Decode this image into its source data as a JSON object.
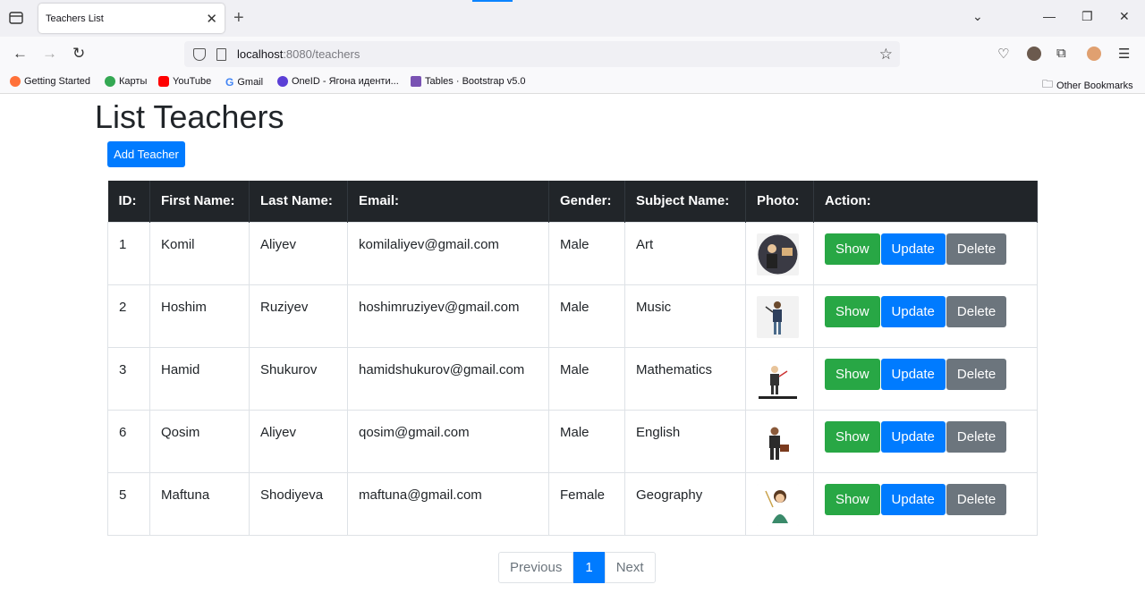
{
  "browser": {
    "tab_title": "Teachers List",
    "url_host": "localhost",
    "url_path": ":8080/teachers",
    "bookmarks": [
      {
        "label": "Getting Started",
        "color": "#ff7139"
      },
      {
        "label": "Карты",
        "color": "#34a853"
      },
      {
        "label": "YouTube",
        "color": "#ff0000"
      },
      {
        "label": "Gmail",
        "color": "#4285f4"
      },
      {
        "label": "OneID - Ягона иденти...",
        "color": "#5b3fd6"
      },
      {
        "label": "Tables · Bootstrap v5.0",
        "color": "#7952b3"
      }
    ],
    "other_bookmarks": "Other Bookmarks"
  },
  "page": {
    "title": "List Teachers",
    "add_button": "Add Teacher"
  },
  "table": {
    "headers": [
      "ID:",
      "First Name:",
      "Last Name:",
      "Email:",
      "Gender:",
      "Subject Name:",
      "Photo:",
      "Action:"
    ],
    "rows": [
      {
        "id": "1",
        "first": "Komil",
        "last": "Aliyev",
        "email": "komilaliyev@gmail.com",
        "gender": "Male",
        "subject": "Art"
      },
      {
        "id": "2",
        "first": "Hoshim",
        "last": "Ruziyev",
        "email": "hoshimruziyev@gmail.com",
        "gender": "Male",
        "subject": "Music"
      },
      {
        "id": "3",
        "first": "Hamid",
        "last": "Shukurov",
        "email": "hamidshukurov@gmail.com",
        "gender": "Male",
        "subject": "Mathematics"
      },
      {
        "id": "6",
        "first": "Qosim",
        "last": "Aliyev",
        "email": "qosim@gmail.com",
        "gender": "Male",
        "subject": "English"
      },
      {
        "id": "5",
        "first": "Maftuna",
        "last": "Shodiyeva",
        "email": "maftuna@gmail.com",
        "gender": "Female",
        "subject": "Geography"
      }
    ],
    "action_labels": {
      "show": "Show",
      "update": "Update",
      "delete": "Delete"
    }
  },
  "pagination": {
    "previous": "Previous",
    "current": "1",
    "next": "Next"
  },
  "colors": {
    "primary": "#007bff",
    "success": "#28a745",
    "secondary": "#6c757d",
    "dark": "#212529"
  }
}
